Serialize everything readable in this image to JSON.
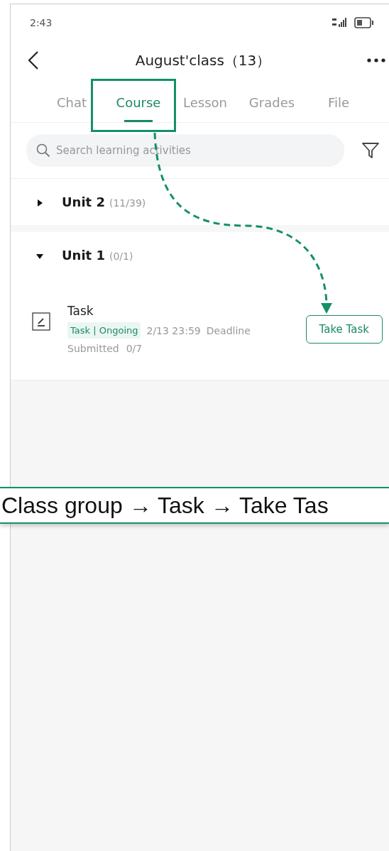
{
  "status_bar": {
    "time": "2:43"
  },
  "header": {
    "title": "August'class（13）"
  },
  "tabs": [
    {
      "label": "Chat",
      "selected": false
    },
    {
      "label": "Course",
      "selected": true
    },
    {
      "label": "Lesson",
      "selected": false
    },
    {
      "label": "Grades",
      "selected": false
    },
    {
      "label": "File",
      "selected": false
    }
  ],
  "search": {
    "placeholder": "Search learning activities"
  },
  "units": [
    {
      "title": "Unit 2",
      "progress": "(11/39)",
      "expanded": false
    },
    {
      "title": "Unit 1",
      "progress": "(0/1)",
      "expanded": true,
      "items": [
        {
          "title": "Task",
          "tag": "Task | Ongoing",
          "due": "2/13 23:59",
          "due_label": "Deadline",
          "submitted_label": "Submitted",
          "submitted": "0/7",
          "action": "Take Task"
        }
      ]
    }
  ],
  "annotation": {
    "caption": "Class group → Task → Take Tas"
  }
}
